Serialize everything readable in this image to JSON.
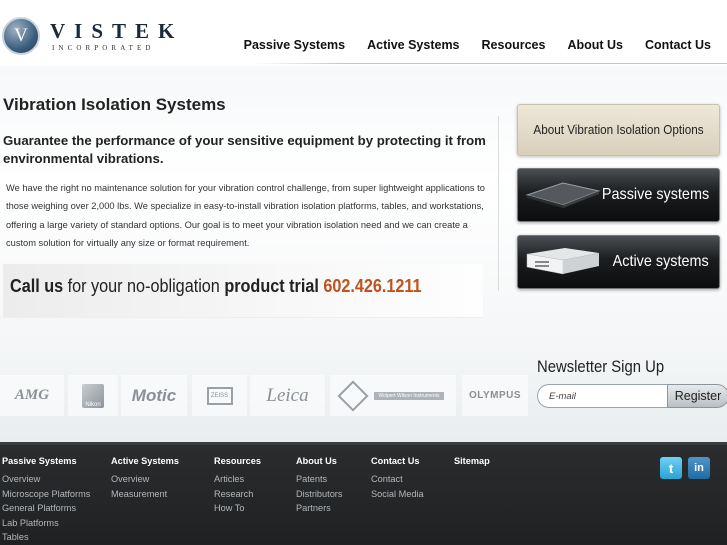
{
  "brand": {
    "name": "VISTEK",
    "sub": "INCORPORATED",
    "mark": "V"
  },
  "nav": [
    {
      "label": "Passive Systems"
    },
    {
      "label": "Active Systems"
    },
    {
      "label": "Resources"
    },
    {
      "label": "About Us"
    },
    {
      "label": "Contact Us"
    }
  ],
  "main": {
    "title": "Vibration Isolation Systems",
    "headline": "Guarantee the performance of your sensitive equipment by protecting it from environmental vibrations.",
    "body": "We have the right no maintenance solution for your vibration control challenge, from super lightweight applications to those weighing over 2,000 lbs. We specialize in easy-to-install vibration isolation platforms, tables, and workstations, offering a large variety of standard options. Our goal is to meet your vibration isolation need and we can create a custom solution for virtually any size or format requirement.",
    "call": {
      "part1": "Call us",
      "part2": " for your no-obligation ",
      "part3": "product trial",
      "phone": "602.426.1211"
    }
  },
  "side": {
    "options_label": "About Vibration Isolation Options",
    "passive_label": "Passive systems",
    "active_label": "Active systems"
  },
  "logos": {
    "amg": "AMG",
    "nikon": "Nikon",
    "motic": "Motic",
    "zeiss": "ZEISS",
    "leica": "Leica",
    "wilson": "Wolpert Wilson Instruments",
    "olympus": "OLYMPUS"
  },
  "newsletter": {
    "title": "Newsletter Sign Up",
    "placeholder": "E-mail",
    "button": "Register"
  },
  "footer": {
    "passive": {
      "head": "Passive Systems",
      "links": [
        "Overview",
        "Microscope Platforms",
        "General Platforms",
        "Lab Platforms",
        "Tables"
      ]
    },
    "active": {
      "head": "Active Systems",
      "links": [
        "Overview",
        "Measurement"
      ]
    },
    "resources": {
      "head": "Resources",
      "links": [
        "Articles",
        "Research",
        "How To"
      ]
    },
    "about": {
      "head": "About Us",
      "links": [
        "Patents",
        "Distributors",
        "Partners"
      ]
    },
    "contact": {
      "head": "Contact Us",
      "links": [
        "Contact",
        "Social Media"
      ]
    },
    "sitemap": {
      "head": "Sitemap"
    },
    "social": {
      "twitter": "t",
      "linkedin": "in"
    }
  },
  "colors": {
    "accent_phone": "#c0521d",
    "footer_bg": "#232527"
  }
}
